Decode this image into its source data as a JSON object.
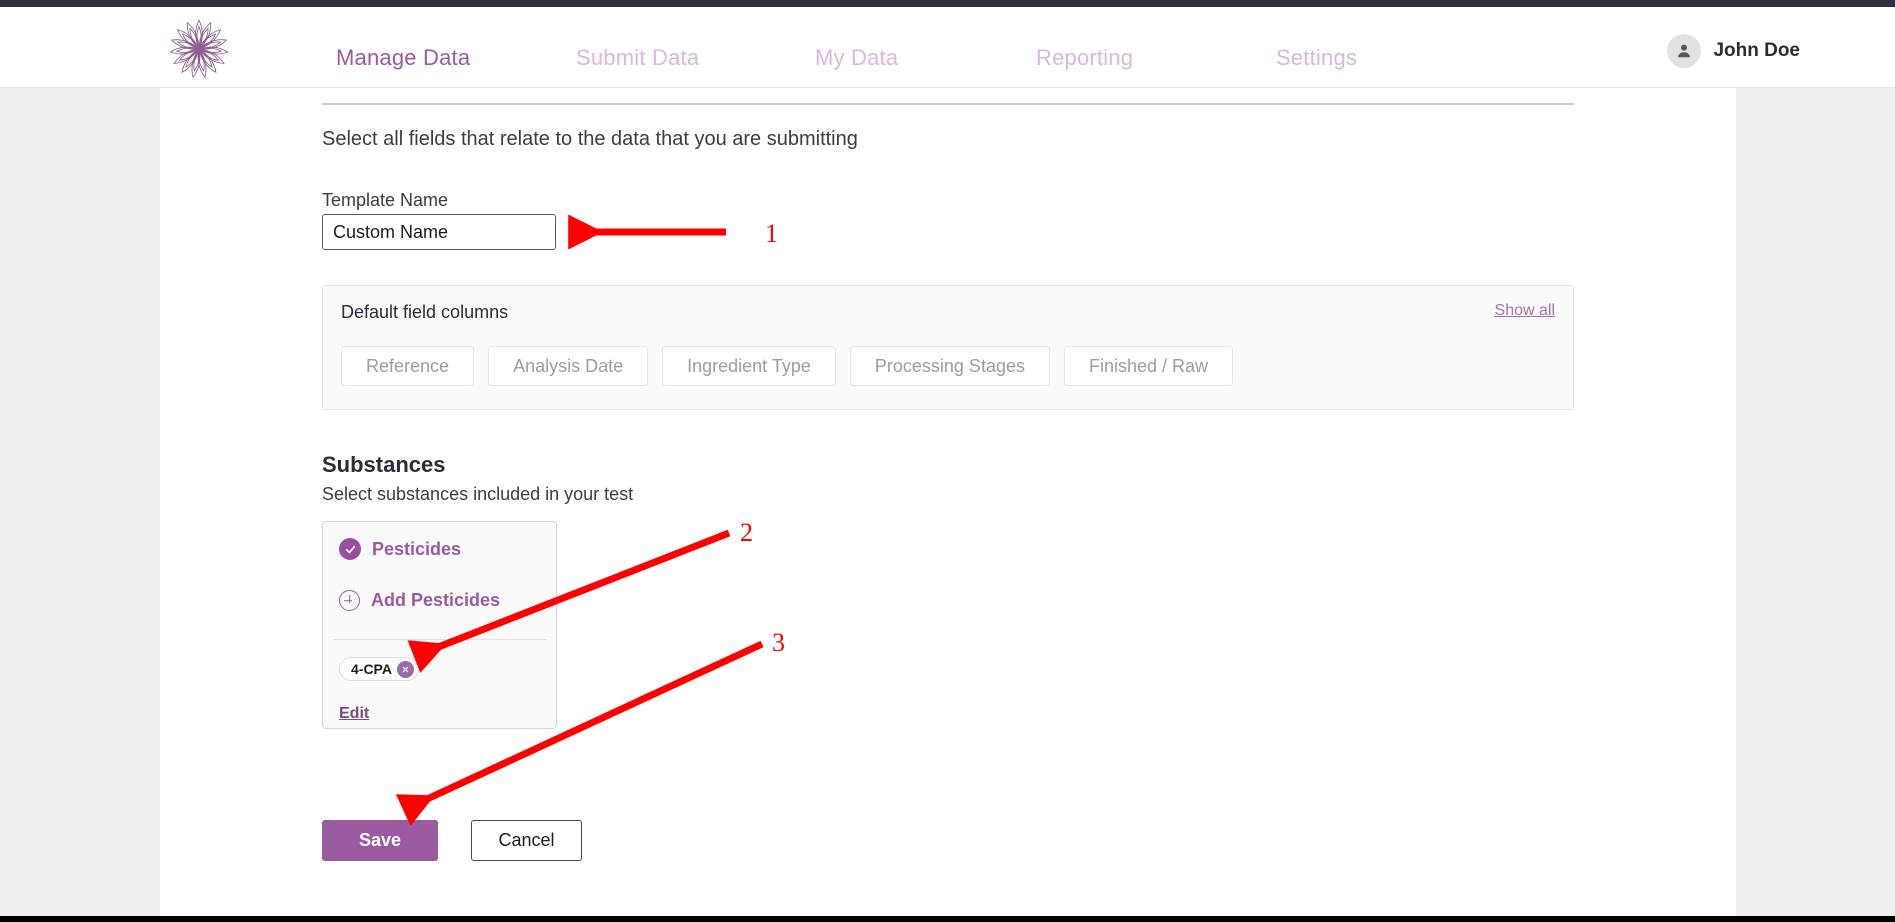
{
  "header": {
    "logo_icon": "flower-mandala-logo",
    "nav": [
      {
        "label": "Manage Data",
        "active": true
      },
      {
        "label": "Submit Data",
        "active": false
      },
      {
        "label": "My Data",
        "active": false
      },
      {
        "label": "Reporting",
        "active": false
      },
      {
        "label": "Settings",
        "active": false
      }
    ],
    "user": {
      "name": "John Doe",
      "avatar_icon": "person-icon"
    }
  },
  "form": {
    "intro": "Select all fields that relate to the data that you are submitting",
    "template_name_label": "Template Name",
    "template_name_value": "Custom Name",
    "template_name_placeholder": "Custom Name"
  },
  "default_fields": {
    "title": "Default field columns",
    "show_all": "Show all",
    "chips": [
      "Reference",
      "Analysis Date",
      "Ingredient Type",
      "Processing Stages",
      "Finished / Raw"
    ]
  },
  "substances": {
    "title": "Substances",
    "subtitle": "Select substances included in your test",
    "group": {
      "name": "Pesticides",
      "checked": true,
      "check_icon": "check-icon",
      "add_label": "Add Pesticides",
      "add_icon": "plus-circle-icon",
      "tags": [
        {
          "label": "4-CPA",
          "remove_icon": "close-icon"
        }
      ],
      "edit_label": "Edit"
    }
  },
  "actions": {
    "save_label": "Save",
    "cancel_label": "Cancel"
  },
  "annotations": [
    {
      "number": "1"
    },
    {
      "number": "2"
    },
    {
      "number": "3"
    }
  ],
  "colors": {
    "brand_purple": "#9a5ba0",
    "brand_purple_light": "#d9b8dc",
    "save_button": "#9a5ba0",
    "annotation_red": "#ff0000",
    "page_background": "#eef0ef",
    "topbar_dark": "#2f323e"
  }
}
